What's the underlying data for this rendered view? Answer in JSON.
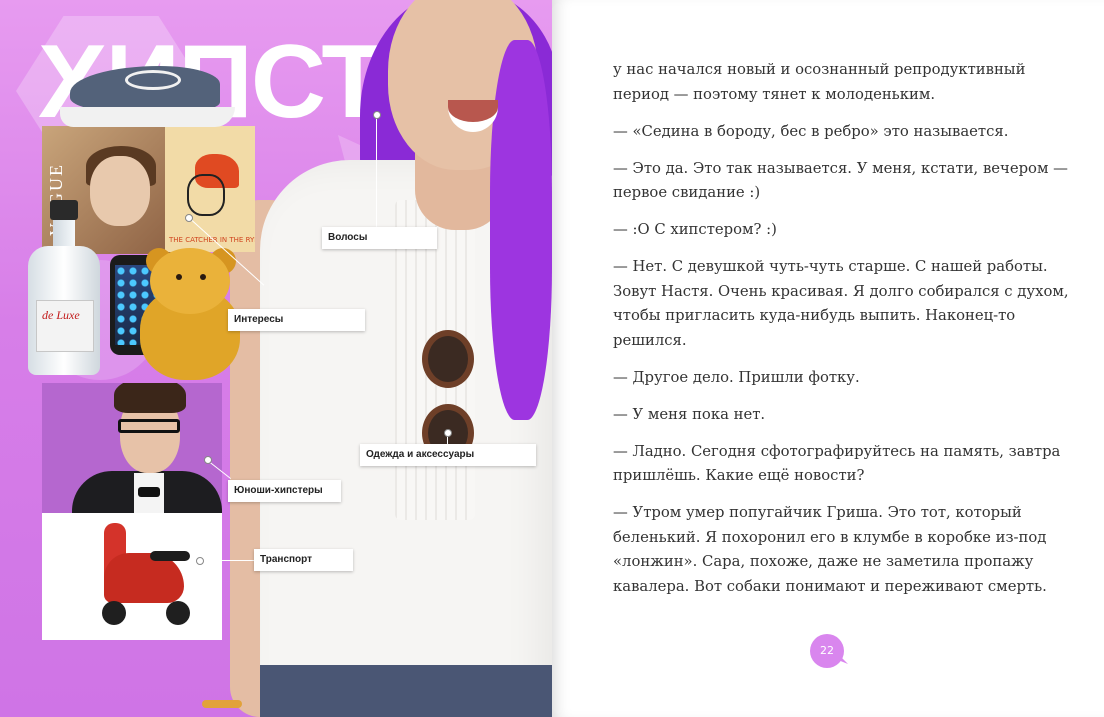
{
  "left_page": {
    "title": "ХИПСТ",
    "callouts": {
      "hair": "Волосы",
      "interests": "Интересы",
      "clothes": "Одежда и аксессуары",
      "boys": "Юноши-хипстеры",
      "transport": "Транспорт"
    },
    "magazine_text": "VOGUE",
    "book_text": "THE CATCHER IN THE RYE",
    "bottle_text": "de Luxe"
  },
  "right_page": {
    "paragraphs": [
      "у нас начался новый и осознанный репродуктивный период — поэтому тянет к молоденьким.",
      "— «Седина в бороду, бес в ребро» это называется.",
      "— Это да. Это так называется. У меня, кстати, вечером — первое свидание :)",
      "— :О С хипстером? :)",
      "— Нет. С девушкой чуть-чуть старше. С нашей работы. Зовут Настя. Очень красивая. Я долго собирался с духом, чтобы пригласить куда-нибудь выпить. Наконец-то решился.",
      "— Другое дело. Пришли фотку.",
      "— У меня пока нет.",
      "— Ладно. Сегодня сфотографируйтесь на память, завтра пришлёшь. Какие ещё новости?",
      "— Утром умер попугайчик Гриша. Это тот, который беленький. Я похоронил его в клумбе в коробке из-под «лонжин». Сара, похоже, даже не заметила пропажу кавалера. Вот собаки понимают и переживают смерть."
    ],
    "page_number": "22"
  },
  "colors": {
    "left_background": "#d77ee8",
    "page_badge": "#d986ee",
    "text": "#333333"
  }
}
